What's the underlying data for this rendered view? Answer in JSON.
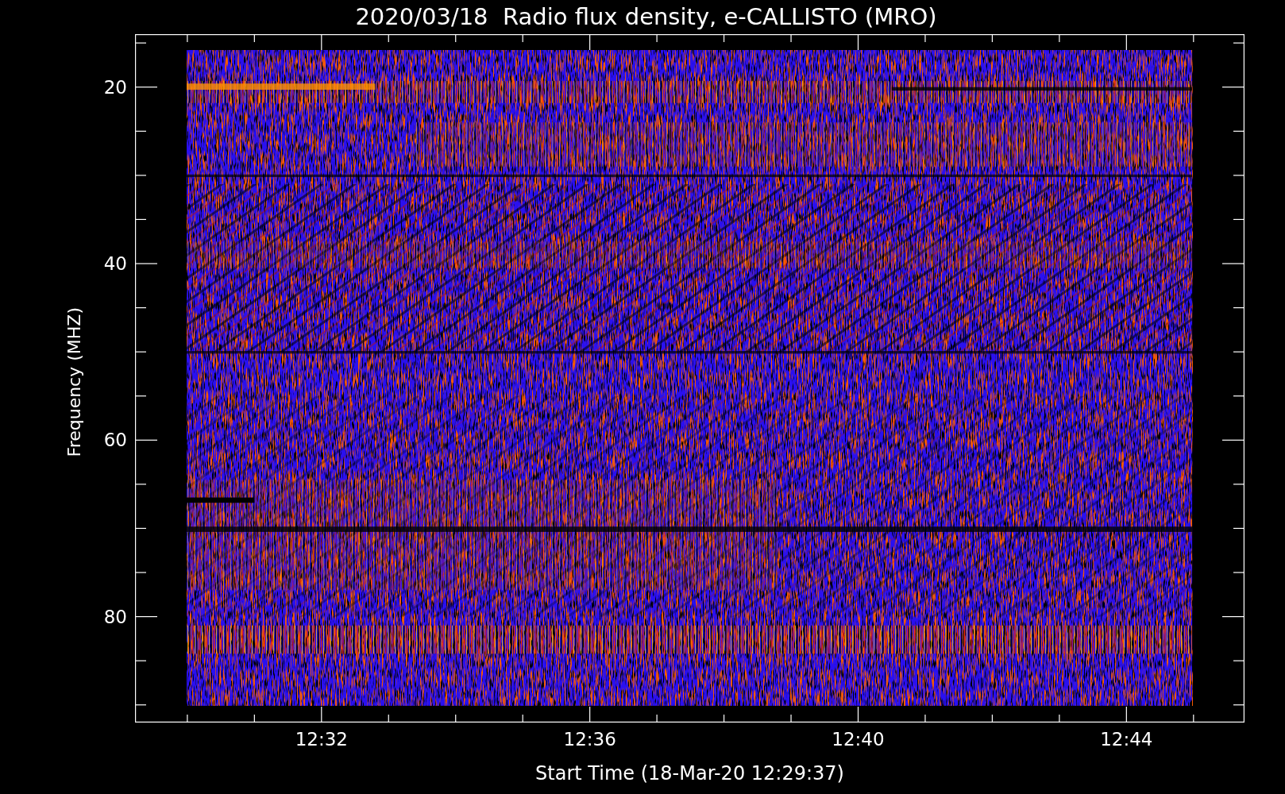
{
  "title": "2020/03/18  Radio flux density, e-CALLISTO (MRO)",
  "y_axis": {
    "label": "Frequency (MHZ)",
    "tick_labels": [
      "20",
      "40",
      "60",
      "80"
    ]
  },
  "x_axis": {
    "label": "Start Time (18-Mar-20 12:29:37)",
    "tick_labels": [
      "12:32",
      "12:36",
      "12:40",
      "12:44"
    ]
  }
}
